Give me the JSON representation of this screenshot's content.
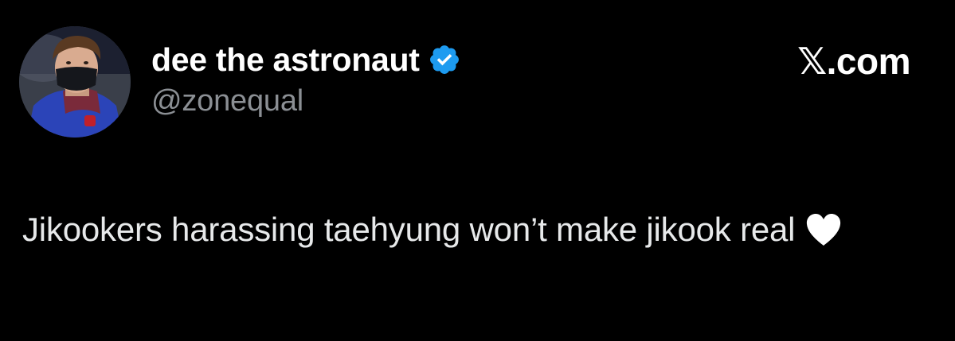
{
  "author": {
    "display_name": "dee the astronaut",
    "handle": "@zonequal",
    "verified": true,
    "verified_icon": "verified-badge-icon",
    "avatar_icon": "profile-photo"
  },
  "brand": {
    "site_label": "𝕏.com"
  },
  "tweet": {
    "text": "Jikookers harassing taehyung won’t make jikook real",
    "emoji": "white-heart-icon"
  },
  "colors": {
    "background": "#000000",
    "name": "#ffffff",
    "handle": "#8b8f94",
    "body_text": "#e7e9ea",
    "verified_blue": "#1d9bf0"
  }
}
